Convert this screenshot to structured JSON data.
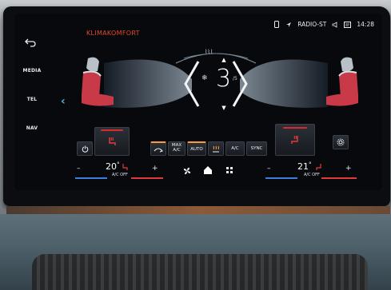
{
  "app": {
    "title": "KLIMAKOMFORT"
  },
  "status_bar": {
    "source": "RADIO-ST",
    "time": "14:28"
  },
  "sidebar": {
    "items": [
      {
        "label": "MEDIA"
      },
      {
        "label": "TEL"
      },
      {
        "label": "NAV"
      }
    ]
  },
  "fan": {
    "level": "3",
    "max": "/5"
  },
  "buttons": {
    "max_ac": "MAX A/C",
    "auto": "AUTO",
    "ac": "A/C",
    "sync": "SYNC"
  },
  "driver": {
    "temperature": "20",
    "unit": "°",
    "ac_status": "A/C OFF",
    "minus": "–",
    "plus": "+"
  },
  "passenger": {
    "temperature": "21",
    "unit": "°",
    "ac_status": "A/C OFF",
    "minus": "–",
    "plus": "+"
  },
  "colors": {
    "title": "#e0472e",
    "heat": "#d52b2b",
    "accent_blue": "#4fb5e6",
    "active": "#ff9a3c"
  }
}
